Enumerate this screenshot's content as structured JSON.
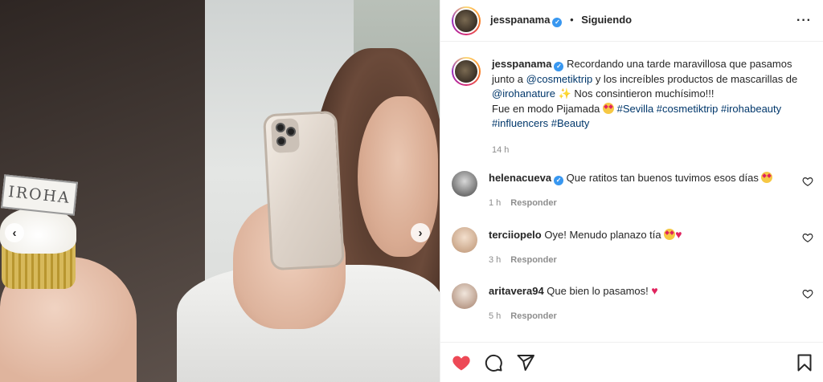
{
  "post": {
    "username": "jesspanama",
    "following_label": "Siguiendo",
    "separator": "•",
    "more_label": "···",
    "caption_parts": {
      "text1": "Recordando una tarde maravillosa que pasamos junto a ",
      "mention1": "@cosmetiktrip",
      "text2": " y los increíbles productos de mascarillas de ",
      "mention2": "@irohanature",
      "text3": " Nos consintieron muchísimo!!!",
      "line2": "Fue en modo Pijamada ",
      "hashtags1": "#Sevilla #cosmetiktrip #irohabeauty",
      "hashtags2": "#influencers #Beauty"
    },
    "caption_time": "14 h",
    "media_tag_text": "IROHA",
    "prev_icon": "‹",
    "next_icon": "›"
  },
  "comments": [
    {
      "username": "helenacueva",
      "verified": true,
      "text": "Que ratitos tan buenos tuvimos esos días",
      "time": "1 h",
      "reply": "Responder"
    },
    {
      "username": "terciiopelo",
      "verified": false,
      "text": "Oye! Menudo planazo tía",
      "time": "3 h",
      "reply": "Responder"
    },
    {
      "username": "aritavera94",
      "verified": false,
      "text": "Que bien lo pasamos!",
      "time": "5 h",
      "reply": "Responder"
    }
  ],
  "actions": {
    "like_icon": "heart-filled-icon",
    "comment_icon": "comment-icon",
    "share_icon": "send-icon",
    "save_icon": "bookmark-icon"
  },
  "colors": {
    "link": "#00376b",
    "verified": "#3897f0",
    "like": "#ed4956",
    "muted": "#8e8e8e"
  }
}
